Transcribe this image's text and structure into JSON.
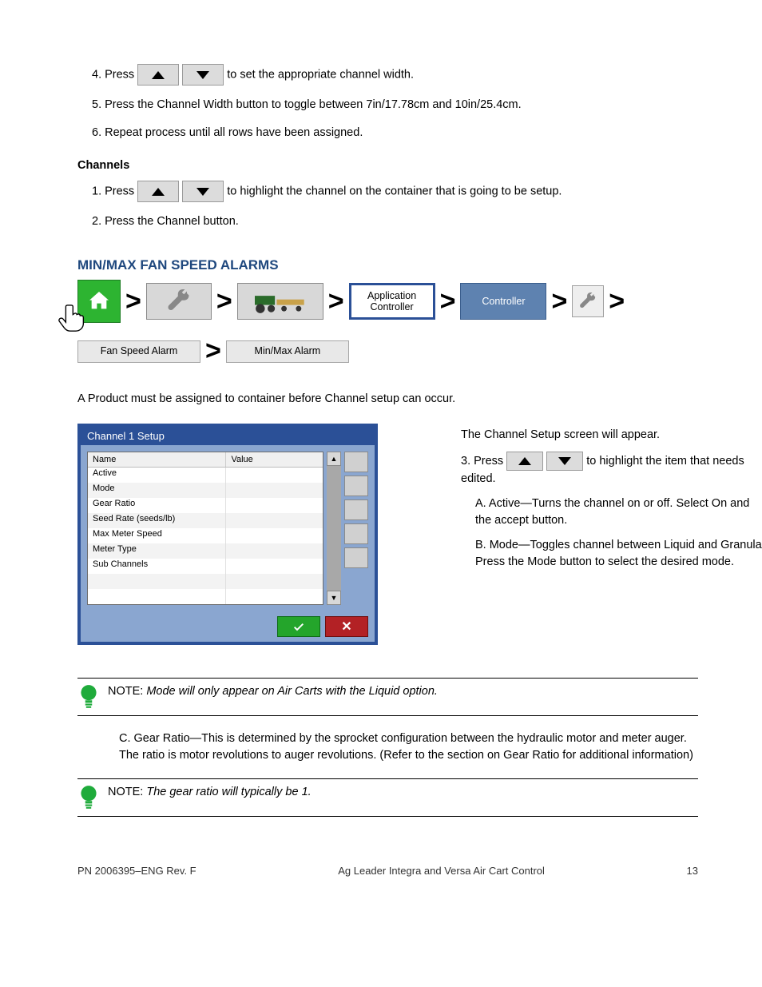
{
  "setup": {
    "line1a": "4. Press ",
    "line1b": " to set the appropriate channel width.",
    "line2": "5. Press the Channel Width button to toggle between 7in/17.78cm and 10in/25.4cm.",
    "line3": "6. Repeat process until all rows have been assigned.",
    "channels": {
      "title": "Channels",
      "line1a": "1. Press ",
      "line1b": " to highlight the channel on the container that is going to be setup.",
      "line2": "2. Press the Channel button."
    }
  },
  "nav": {
    "app_config": "Application Controller",
    "controller": "Controller",
    "fan_speed_alarm": "Fan Speed Alarm",
    "min_max_alarm": "Min/Max Alarm"
  },
  "prod_label": "A Product must be assigned to container before Channel setup can occur.",
  "window": {
    "title": "Channel 1 Setup",
    "col1": "Name",
    "col2": "Value",
    "rows": [
      [
        "Active",
        ""
      ],
      [
        "Mode",
        ""
      ],
      [
        "Gear Ratio",
        ""
      ],
      [
        "Seed Rate (seeds/lb)",
        ""
      ],
      [
        "Max Meter Speed",
        ""
      ],
      [
        "Meter Type",
        ""
      ],
      [
        "Sub Channels",
        ""
      ],
      [
        "",
        ""
      ],
      [
        "",
        ""
      ]
    ]
  },
  "aside": {
    "txt1": "The Channel Setup screen will appear.",
    "txt2a": "3. Press ",
    "txt2b": " to highlight the item that needs edited.",
    "txt3": "A. Active—Turns the channel on or off. Select On and the accept button.",
    "txt4": "B. Mode—Toggles channel between Liquid and Granular. Press the Mode button to select the desired mode."
  },
  "note1": "NOTE: Mode will only appear on Air Carts with the Liquid option.",
  "body1": "C. Gear Ratio—This is determined by the sprocket configuration between the hydraulic motor and meter auger. The ratio is motor revolutions to auger revolutions. (Refer to the section on Gear Ratio for additional information)",
  "note2": "NOTE: The gear ratio will typically be 1.",
  "footer": {
    "left": "PN 2006395–ENG Rev. F",
    "center": "Ag Leader Integra and Versa Air Cart Control",
    "right": "13"
  }
}
